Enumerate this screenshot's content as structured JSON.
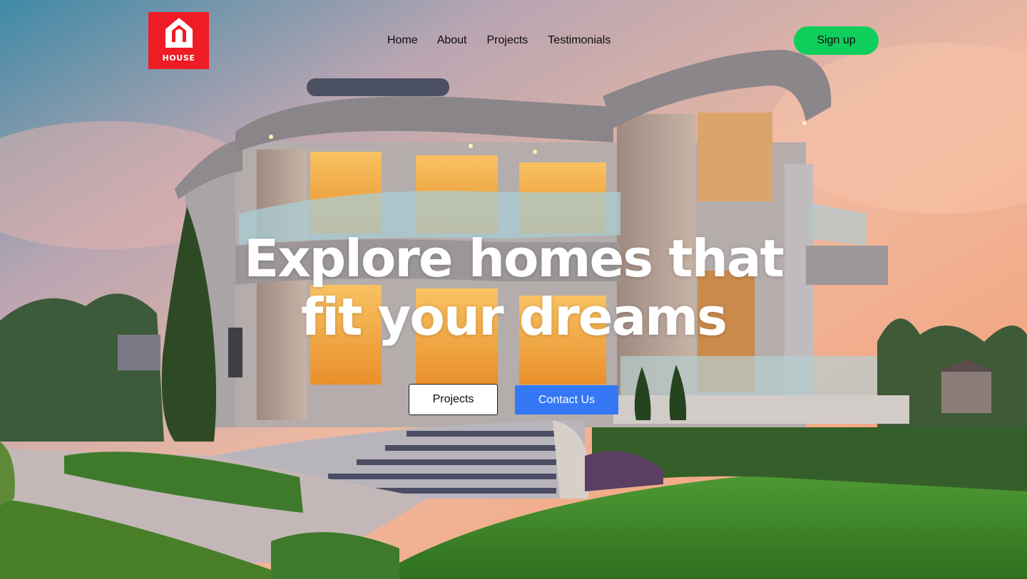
{
  "header": {
    "logo": {
      "text": "HOUSE",
      "icon": "house-logo-icon",
      "color": "#ee1c25"
    },
    "nav": [
      {
        "label": "Home"
      },
      {
        "label": "About"
      },
      {
        "label": "Projects"
      },
      {
        "label": "Testimonials"
      }
    ],
    "signup_label": "Sign up",
    "signup_color": "#0fcf5c"
  },
  "hero": {
    "headline_line1": "Explore homes that",
    "headline_line2": "fit your dreams",
    "background": "house-sunset-photo",
    "buttons": {
      "projects_label": "Projects",
      "contact_label": "Contact Us",
      "contact_color": "#3478f6"
    }
  }
}
